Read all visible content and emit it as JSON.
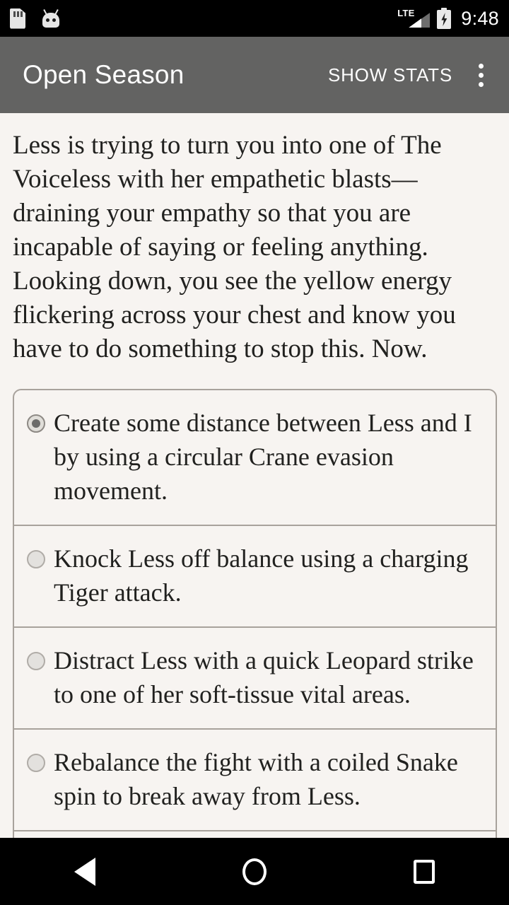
{
  "status_bar": {
    "icons": [
      "sd-card-icon",
      "android-bugdroid-icon"
    ],
    "network_label": "LTE",
    "battery": "charging",
    "clock": "9:48"
  },
  "app_bar": {
    "title": "Open Season",
    "action_label": "SHOW STATS",
    "overflow_label": "⋮",
    "background_color": "#636362"
  },
  "story": {
    "text": "Less is trying to turn you into one of The Voiceless with her empathetic blasts—draining your empathy so that you are incapable of saying or feeling anything. Looking down, you see the yellow energy flickering across your chest and know you have to do something to stop this. Now."
  },
  "options": [
    {
      "label": "Create some distance between Less and I by using a circular Crane evasion movement.",
      "selected": true
    },
    {
      "label": "Knock Less off balance using a charging Tiger attack.",
      "selected": false
    },
    {
      "label": "Distract Less with a quick Leopard strike to one of her soft-tissue vital areas.",
      "selected": false
    },
    {
      "label": "Rebalance the fight with a coiled Snake spin to break away from Less.",
      "selected": false
    },
    {
      "label": "",
      "selected": false
    }
  ],
  "nav_bar": {
    "back": "back-triangle",
    "home": "home-circle",
    "recents": "recents-square"
  },
  "colors": {
    "page_background": "#f7f4f1",
    "app_bar": "#636362",
    "text": "#21211f",
    "divider": "#a8a29c"
  }
}
